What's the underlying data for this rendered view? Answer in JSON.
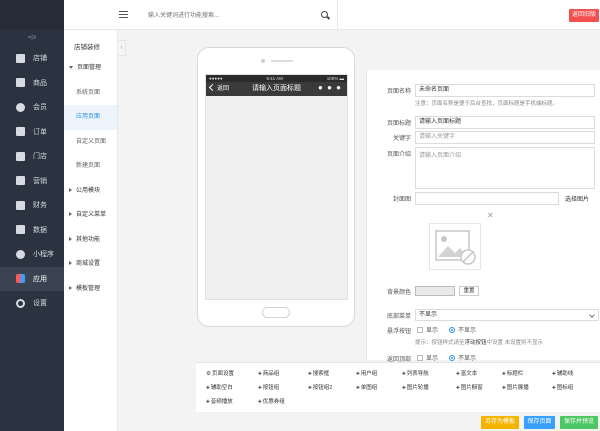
{
  "sidebar": {
    "toggle": "=|≡",
    "items": [
      {
        "label": "店铺",
        "icon": "shop-icon"
      },
      {
        "label": "商品",
        "icon": "goods-icon"
      },
      {
        "label": "会员",
        "icon": "member-icon"
      },
      {
        "label": "订单",
        "icon": "order-icon"
      },
      {
        "label": "门店",
        "icon": "store-icon"
      },
      {
        "label": "营销",
        "icon": "marketing-icon"
      },
      {
        "label": "财务",
        "icon": "finance-icon"
      },
      {
        "label": "数据",
        "icon": "data-icon"
      },
      {
        "label": "小程序",
        "icon": "miniprogram-icon"
      },
      {
        "label": "应用",
        "icon": "app-icon"
      },
      {
        "label": "设置",
        "icon": "gear-icon"
      }
    ],
    "active": "应用"
  },
  "submenu": {
    "title": "店铺装修",
    "groups": [
      {
        "label": "页面管理",
        "expanded": true,
        "items": [
          "系统页面",
          "应用页面",
          "自定义页面",
          "新建页面"
        ]
      },
      {
        "label": "公用模块"
      },
      {
        "label": "自定义菜单"
      },
      {
        "label": "其他功能"
      },
      {
        "label": "商城设置"
      },
      {
        "label": "模板管理"
      }
    ],
    "active_item": "应用页面",
    "collapse": "‹"
  },
  "topbar": {
    "search_placeholder": "输入关键词进行功能搜索...",
    "back_button": "返回旧版"
  },
  "phone": {
    "status_left": "●●●●● ",
    "status_time": "9:41 AM",
    "status_right": "100% ▬",
    "back": "返回",
    "title": "请输入页面标题",
    "more": "● ● ●"
  },
  "form": {
    "page_name_label": "页面名称",
    "page_name_value": "未命名页面",
    "page_name_hint": "注意：页面名称是便于后台查找，页面标题是手机端标题。",
    "page_title_label": "页面标题",
    "page_title_value": "请输入页面标题",
    "keywords_label": "关键字",
    "keywords_placeholder": "请输入关键字",
    "intro_label": "页面介绍",
    "intro_placeholder": "请输入页面介绍",
    "cover_label": "封面图",
    "cover_button": "选择图片",
    "cover_close": "✕",
    "bg_color_label": "背景颜色",
    "bg_color": "#e9e9e9",
    "reset_button": "重置",
    "bottom_menu_label": "底部菜单",
    "bottom_menu_value": "不显示",
    "float_button_label": "悬浮按钮",
    "show": "显示",
    "hide": "不显示",
    "float_hint_prefix": "提示：按钮样式请至",
    "float_hint_link": "浮动按钮",
    "float_hint_suffix": "中设置 未设置则不显示",
    "back_top_label": "返回顶部",
    "back_top_show": "显示",
    "back_top_hide": "不显示"
  },
  "components": [
    "页面设置",
    "商品组",
    "搜索框",
    "用户组",
    "列表导航",
    "富文本",
    "标题栏",
    "辅助线",
    "辅助空白",
    "按钮组",
    "按钮组2",
    "单图组",
    "图片轮播",
    "图片橱窗",
    "图片展播",
    "图标组",
    "音频播放",
    "优惠券组"
  ],
  "actions": {
    "save_template": "另存为模板",
    "save_page": "保存页面",
    "save_preview": "保存并预览"
  },
  "colors": {
    "sidebar_bg": "#2b3340",
    "accent_red": "#f54e4e",
    "accent_blue": "#2d8cf0",
    "btn_yellow": "#f5b400",
    "btn_blue": "#3aa0ff",
    "btn_green": "#4cc764"
  }
}
